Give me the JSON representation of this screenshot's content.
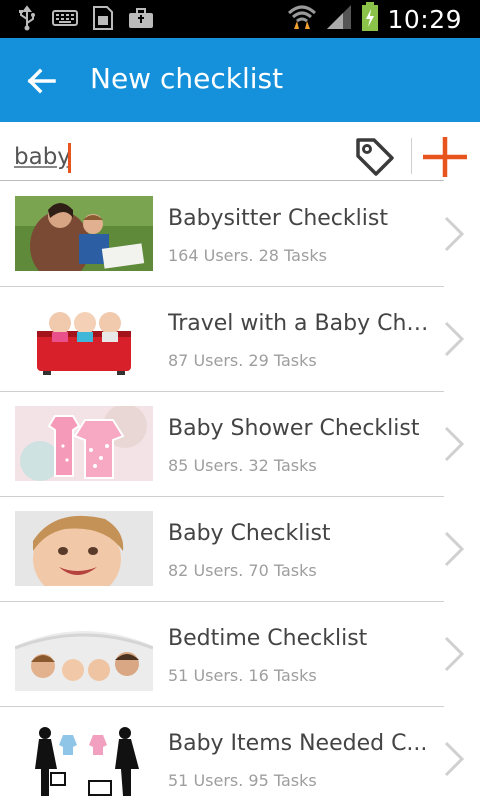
{
  "status_bar": {
    "time": "10:29",
    "icons": [
      "usb-icon",
      "keyboard-icon",
      "sim-card-icon",
      "briefcase-icon",
      "wifi-icon",
      "signal-icon",
      "battery-charging-icon"
    ]
  },
  "app_bar": {
    "title": "New checklist",
    "back_icon": "arrow-left-icon"
  },
  "search": {
    "value": "baby",
    "tag_icon": "tag-icon",
    "add_icon": "plus-icon"
  },
  "colors": {
    "app_bar": "#1591dc",
    "accent": "#e8541e",
    "title_text": "#444444",
    "meta_text": "#9e9e9e"
  },
  "results": [
    {
      "title": "Babysitter Checklist",
      "meta": "164 Users. 28 Tasks",
      "thumb": "woman-and-child-reading"
    },
    {
      "title": "Travel with a Baby Che...",
      "meta": "87 Users. 29 Tasks",
      "thumb": "babies-in-red-suitcase"
    },
    {
      "title": "Baby Shower Checklist",
      "meta": "85 Users. 32 Tasks",
      "thumb": "pink-onesie-cookies"
    },
    {
      "title": "Baby Checklist",
      "meta": "82 Users. 70 Tasks",
      "thumb": "smiling-toddler"
    },
    {
      "title": "Bedtime Checklist",
      "meta": "51 Users. 16 Tasks",
      "thumb": "family-under-blanket"
    },
    {
      "title": "Baby Items Needed C...",
      "meta": "51 Users. 95 Tasks",
      "thumb": "pregnant-silhouettes"
    }
  ]
}
